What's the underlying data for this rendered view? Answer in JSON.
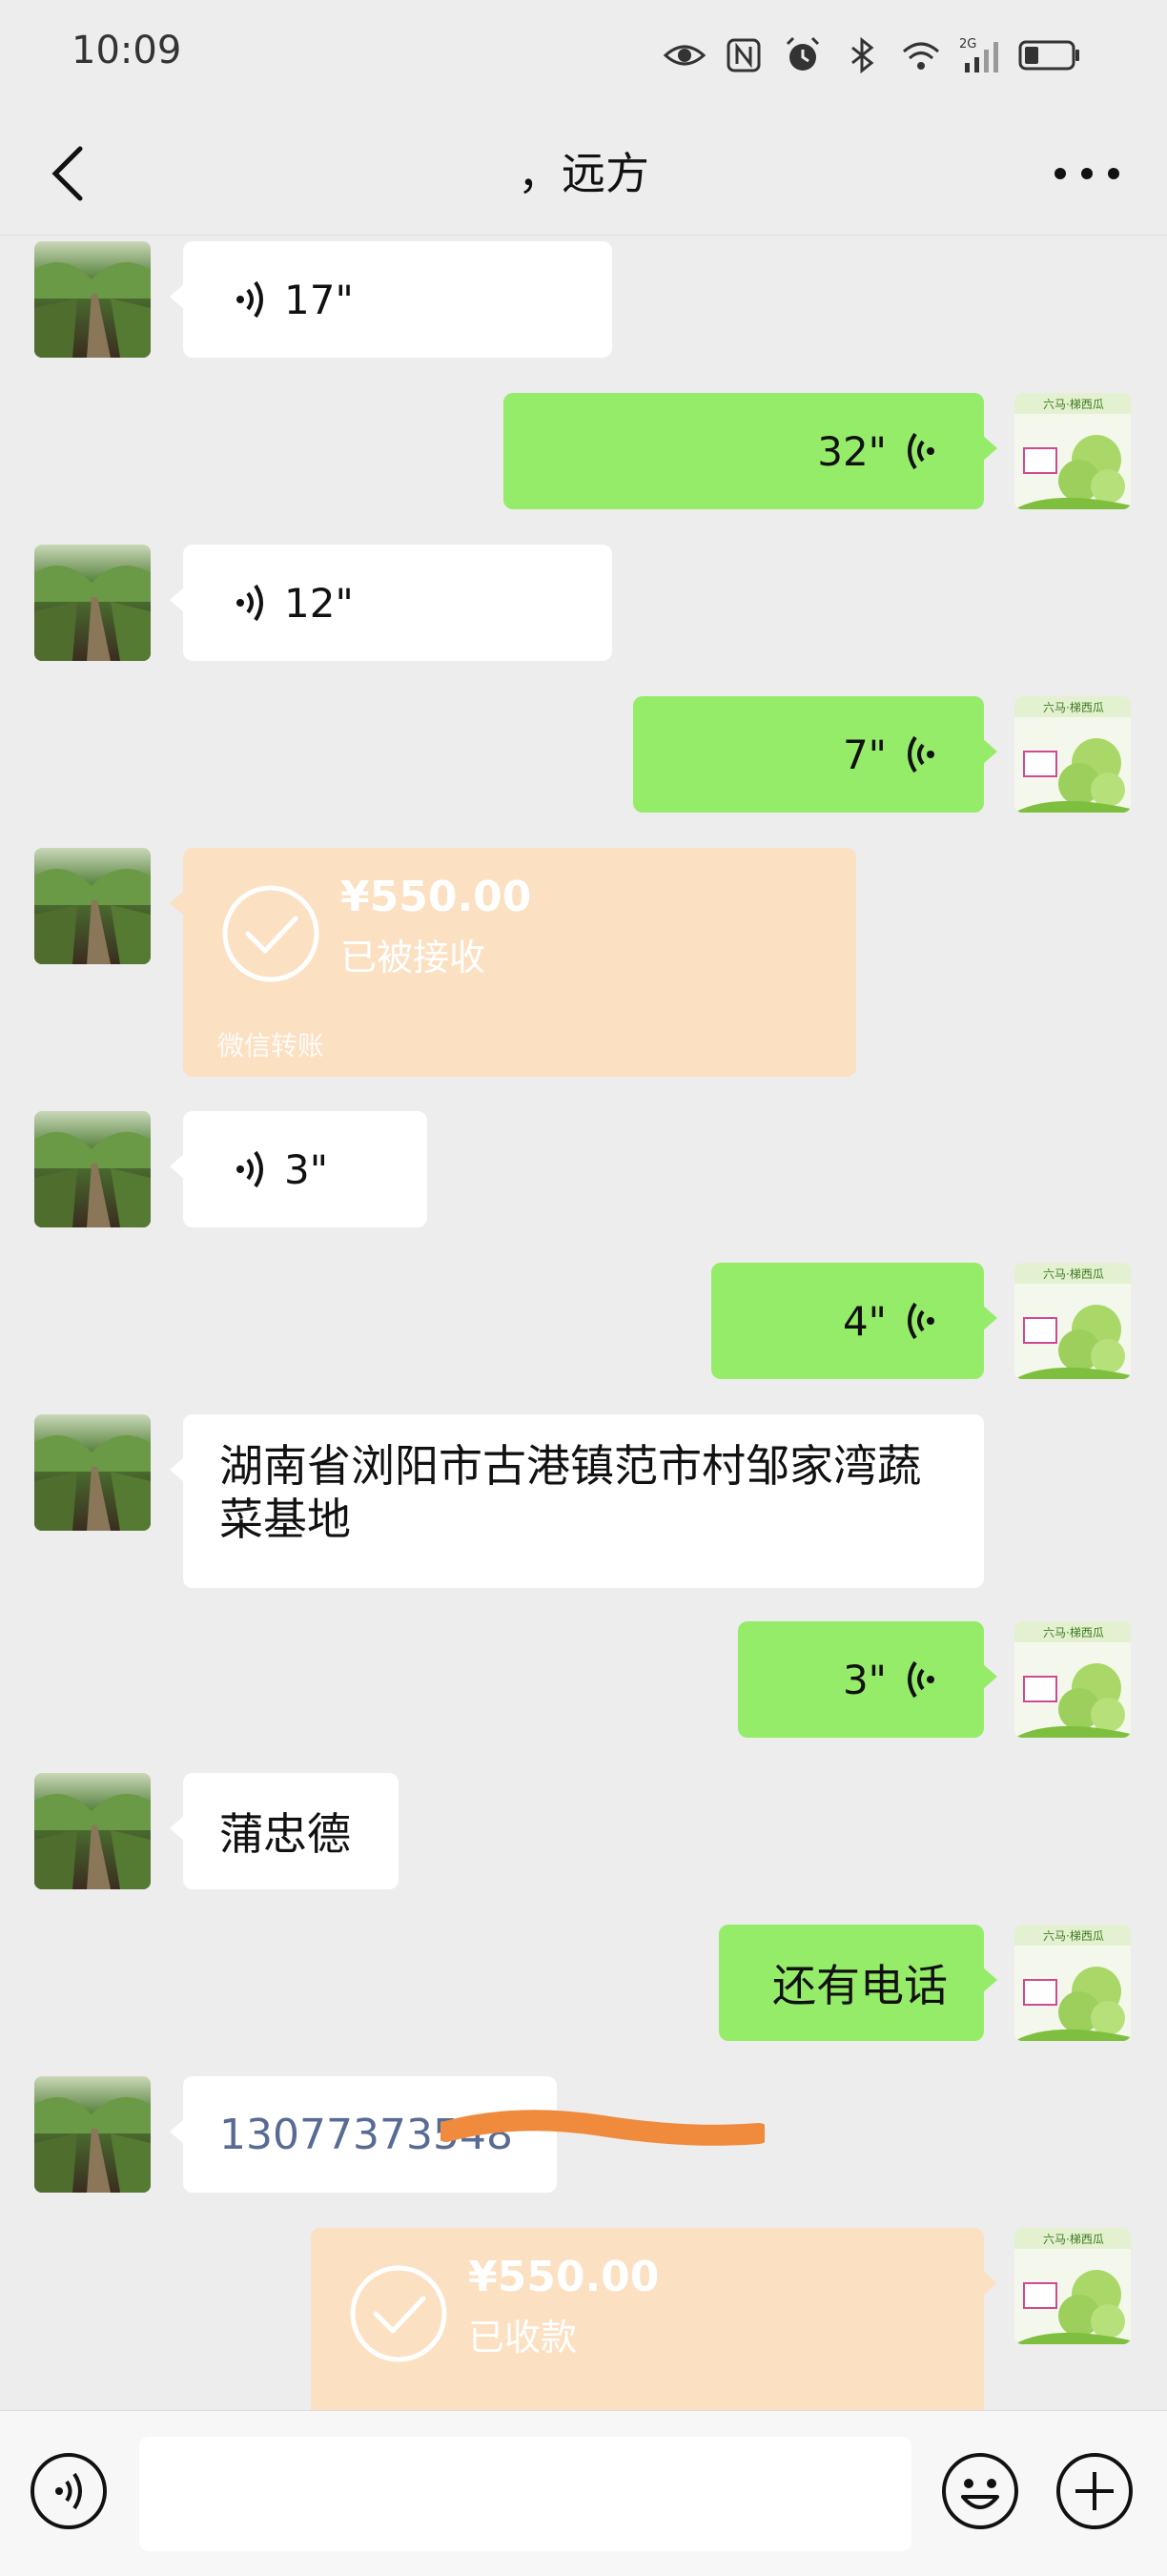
{
  "status_bar": {
    "time": "10:09",
    "icons": [
      "eye-icon",
      "nfc-icon",
      "alarm-icon",
      "bluetooth-icon",
      "wifi-icon",
      "signal-icon",
      "battery-icon"
    ],
    "network_label": "2G"
  },
  "nav": {
    "title": "，远方",
    "back_icon": "chevron-left-icon",
    "more_icon": "more-dots-icon"
  },
  "colors": {
    "background": "#ededed",
    "incoming_bubble": "#ffffff",
    "outgoing_bubble": "#95ec69",
    "transfer_card": "#fce0c2",
    "redaction": "#f08a3c",
    "phone_link": "#576b95"
  },
  "messages": [
    {
      "side": "left",
      "type": "voice",
      "duration": "17\""
    },
    {
      "side": "right",
      "type": "voice",
      "duration": "32\""
    },
    {
      "side": "left",
      "type": "voice",
      "duration": "12\""
    },
    {
      "side": "right",
      "type": "voice",
      "duration": "7\""
    },
    {
      "side": "left",
      "type": "transfer",
      "amount": "¥550.00",
      "status": "已被接收",
      "footer": "微信转账"
    },
    {
      "side": "left",
      "type": "voice",
      "duration": "3\""
    },
    {
      "side": "right",
      "type": "voice",
      "duration": "4\""
    },
    {
      "side": "left",
      "type": "text",
      "text": "湖南省浏阳市古港镇范市村邹家湾蔬菜基地"
    },
    {
      "side": "right",
      "type": "voice",
      "duration": "3\""
    },
    {
      "side": "left",
      "type": "text",
      "text": "蒲忠德"
    },
    {
      "side": "right",
      "type": "text",
      "text": "还有电话"
    },
    {
      "side": "left",
      "type": "phone",
      "text": "13077373548",
      "redacted": true
    },
    {
      "side": "right",
      "type": "transfer",
      "amount": "¥550.00",
      "status": "已收款"
    }
  ],
  "input_bar": {
    "voice_icon": "voice-mode-icon",
    "input_value": "",
    "emoji_icon": "emoji-icon",
    "plus_icon": "plus-icon"
  }
}
